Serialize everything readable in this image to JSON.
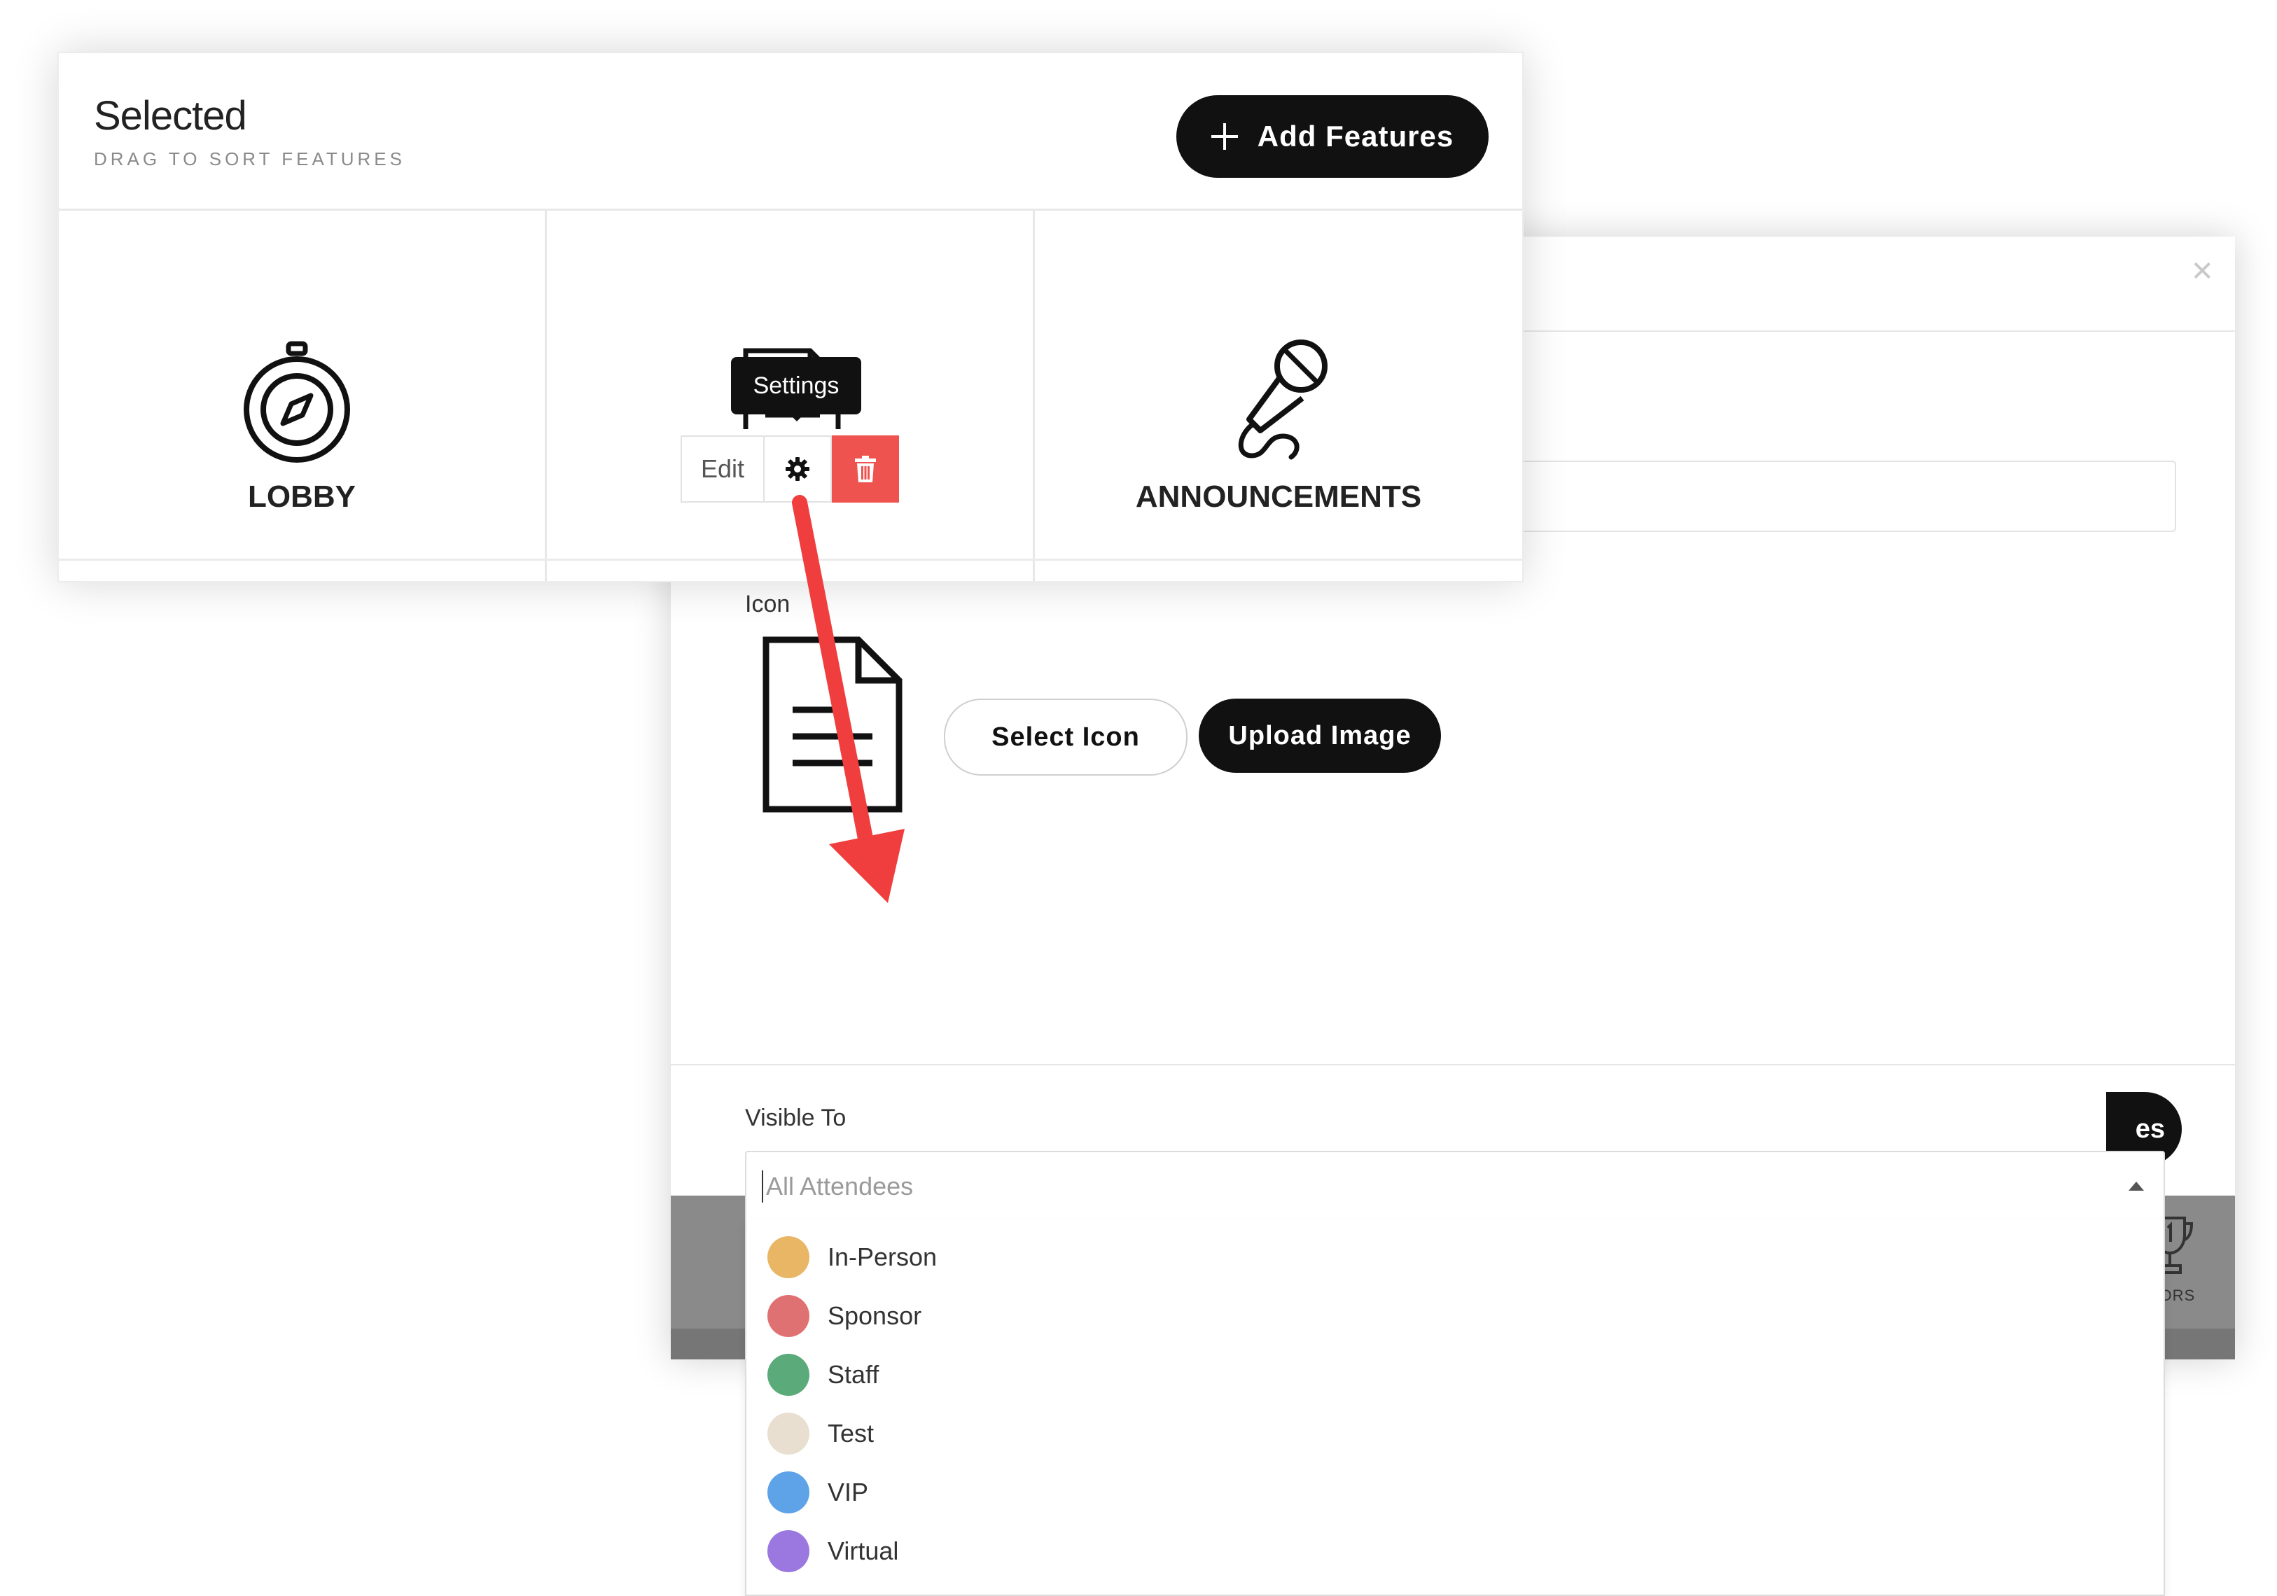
{
  "selected_card": {
    "title": "Selected",
    "subtitle": "DRAG TO SORT FEATURES",
    "add_features_label": "Add Features",
    "features": [
      {
        "label": "LOBBY",
        "icon": "compass-icon"
      },
      {
        "label": "",
        "icon": "document-icon"
      },
      {
        "label": "ANNOUNCEMENTS",
        "icon": "microphone-icon"
      }
    ],
    "tooltip": "Settings",
    "actions": {
      "edit_label": "Edit",
      "settings_icon": "gear-icon",
      "delete_icon": "trash-icon"
    }
  },
  "modal": {
    "close_icon": "close-icon",
    "icon_label": "Icon",
    "preview_icon": "document-icon",
    "select_icon_label": "Select Icon",
    "upload_image_label": "Upload Image",
    "visible_to_label": "Visible To",
    "visible_to_placeholder": "All Attendees",
    "save_button_partial": "es",
    "bg_feature_label_partial": "NSORS",
    "options": [
      {
        "label": "In-Person",
        "color": "#E9B665"
      },
      {
        "label": "Sponsor",
        "color": "#E07173"
      },
      {
        "label": "Staff",
        "color": "#5AAA7A"
      },
      {
        "label": "Test",
        "color": "#E8DFD0"
      },
      {
        "label": "VIP",
        "color": "#5EA3E8"
      },
      {
        "label": "Virtual",
        "color": "#9A78DF"
      }
    ]
  },
  "colors": {
    "accent_dark": "#111111",
    "danger": "#EF5350",
    "annotation_arrow": "#F03E3E"
  }
}
